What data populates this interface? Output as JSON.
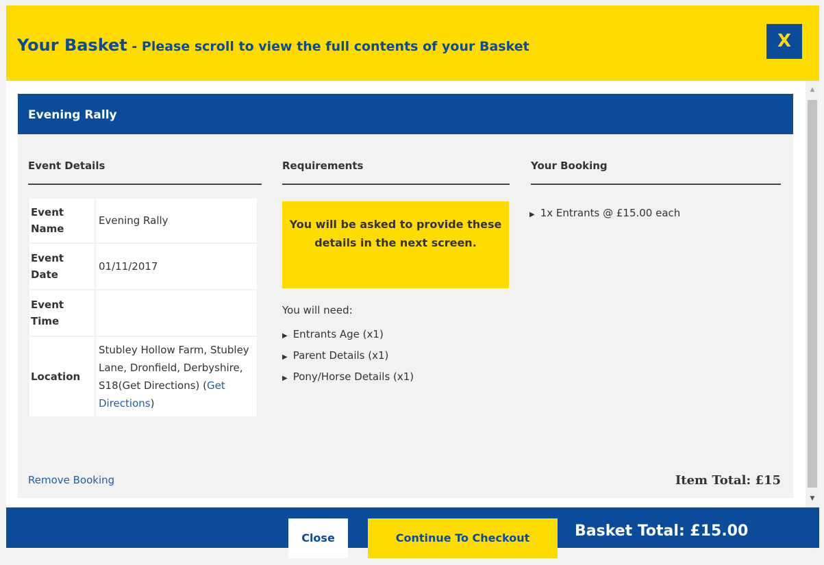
{
  "header": {
    "title": "Your Basket",
    "subtitle": " - Please scroll to view the full contents of your Basket",
    "close_label": "X"
  },
  "event": {
    "name": "Evening Rally",
    "columns": {
      "details": "Event Details",
      "requirements": "Requirements",
      "booking": "Your Booking"
    },
    "details": {
      "name_label": "Event Name",
      "name_value": "Evening Rally",
      "date_label": "Event Date",
      "date_value": "01/11/2017",
      "time_label": "Event Time",
      "time_value": "",
      "location_label": "Location",
      "location_value": "Stubley Hollow Farm, Stubley Lane, Dronfield, Derbyshire, S18(Get Directions) (",
      "location_link": "Get Directions",
      "location_close": ")"
    },
    "requirements": {
      "notice": "You will be asked to provide these details in the next screen.",
      "need_label": "You will need:",
      "items": [
        "Entrants Age (x1)",
        "Parent Details (x1)",
        "Pony/Horse Details (x1)"
      ]
    },
    "booking": {
      "items": [
        "1x Entrants @ £15.00 each"
      ]
    },
    "remove_label": "Remove Booking",
    "item_total": "Item Total: £15"
  },
  "footer": {
    "close_label": "Close",
    "checkout_label": "Continue To Checkout",
    "basket_total": "Basket Total: £15.00"
  },
  "colors": {
    "brand_blue": "#0a4c9a",
    "brand_yellow": "#ffdc00"
  }
}
